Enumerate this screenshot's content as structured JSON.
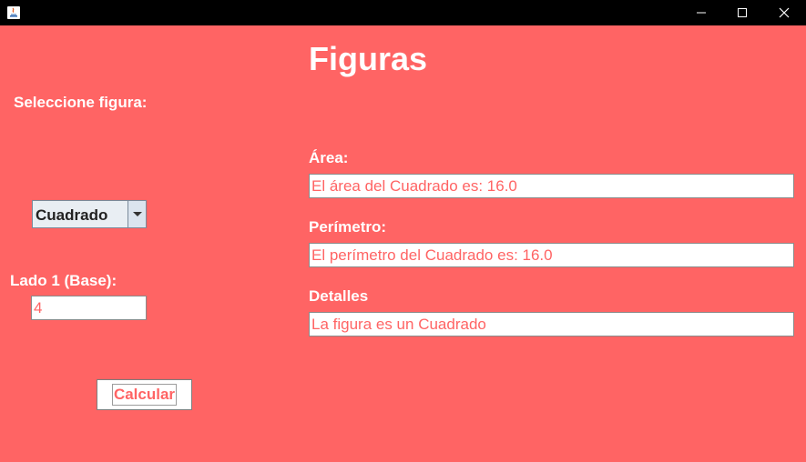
{
  "window": {
    "title": "Figuras",
    "controls": [
      "minimize-icon",
      "maximize-icon",
      "close-icon"
    ]
  },
  "form": {
    "select_label": "Seleccione figura:",
    "shape_selected": "Cuadrado",
    "side_label": "Lado 1 (Base):",
    "side_value": "4",
    "button_label": "Calcular"
  },
  "results": {
    "area_label": "Área:",
    "area_value": "El área del Cuadrado es: 16.0",
    "perimeter_label": "Perímetro:",
    "perimeter_value": "El perímetro del Cuadrado es: 16.0",
    "details_label": "Detalles",
    "details_value": "La figura es un Cuadrado"
  },
  "colors": {
    "background": "#ff6464",
    "titlebar": "#000000",
    "text_light": "#ffffff",
    "accent_text": "#ff6464"
  }
}
